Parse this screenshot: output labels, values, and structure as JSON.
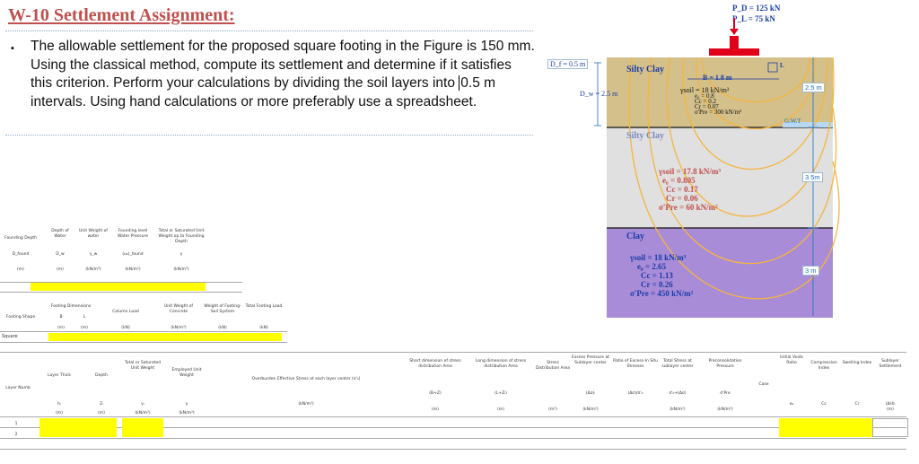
{
  "title": "W-10 Settlement Assignment:",
  "paragraph": {
    "bullet": "▪",
    "before": "The allowable settlement for the proposed square footing in the Figure is 150 mm. Using the classical method, compute its settlement and determine if it satisfies this criterion. Perform your calculations by dividing the soil layers into ",
    "highlight": "0.5 m",
    "after": " intervals. Using hand calculations or more preferably use a spreadsheet."
  },
  "figure": {
    "pd": "P_D = 125 kN",
    "pl": "P_L = 75 kN",
    "df": "D_f = 0.5 m",
    "dw": "D_w = 2.5 m",
    "b": "B = 1.8 m",
    "l_mark": "L",
    "gwt": "G.W.T",
    "dims": [
      "2.5 m",
      "3.5m",
      "3 m"
    ],
    "layer1": {
      "name": "Silty Clay",
      "gamma": "γsoil = 18 kN/m³",
      "e": "e₀ = 0.8",
      "cc": "Cc = 0.2",
      "cr": "Cr = 0.07",
      "pc": "σ'Pre = 300 kN/m²"
    },
    "layer2": {
      "name": "Silty Clay",
      "gamma": "γsoil = 17.8 kN/m³",
      "e": "e₀ = 0.805",
      "cc": "Cc = 0.17",
      "cr": "Cr = 0.06",
      "pc": "σ'Pre = 60 kN/m²"
    },
    "layer3": {
      "name": "Clay",
      "gamma": "γsoil = 18 kN/m³",
      "e": "e₀ = 2.65",
      "cc": "Cc = 1.13",
      "cr": "Cr = 0.26",
      "pc": "σ'Pre = 450 kN/m²"
    },
    "colors": {
      "layer1": "#d4c08a",
      "layer2": "#e0e0e0",
      "layer3": "#a98cd8",
      "footing": "#e0001a",
      "accent": "#c0504d"
    }
  },
  "sheet_top": {
    "headers": [
      "Founding Depth",
      "Depth of Water",
      "Unit Weight of water",
      "Founding level Water Pressure",
      "Total or Saturated Unit Weight up to Founding Depth"
    ],
    "symbols": [
      "D_found",
      "D_w",
      "γ_w",
      "(u₀)_found",
      "γ"
    ],
    "units": [
      "(m)",
      "(m)",
      "(kN/m³)",
      "(kN/m²)",
      "(kN/m³)"
    ]
  },
  "sheet_mid": {
    "headers": [
      "Footing Shape",
      "Footing Dimensions",
      "Column Load",
      "Unit Weight of Concrete",
      "Weight of Footing-Soil System",
      "Total Footing Load"
    ],
    "dims": [
      "B",
      "L"
    ],
    "units": [
      "(m)",
      "(m)",
      "(kN)",
      "(kN/m³)",
      "(kN)",
      "(kN)"
    ],
    "shape_value": "Square"
  },
  "sheet_bottom": {
    "headers": [
      "Layer Numb",
      "Layer Thick",
      "Depth",
      "Total or Saturated Unit Weight",
      "Employed Unit Weight",
      "Overburden Effective Stress at each layer center (σ'₀)",
      "Short dimension of stress distribution Area",
      "Long dimension of stress distribution Area",
      "Stress Distribution Area",
      "Excess Pressure at Sublayer center",
      "Ratio of Excess-In Situ Stresses",
      "Total Stress at sublayer center",
      "Preconsolidation Pressure",
      "Case",
      "Initial Voids Ratio",
      "Compression Index",
      "Swelling Index",
      "Sublayer Settlement"
    ],
    "symbols": [
      "",
      "hᵢ",
      "Zᵢ",
      "γᵢ",
      "γ",
      "(kN/m²)",
      "(B+Z)",
      "(L+Zᵢ)",
      "",
      "(Δσ)ᵢ",
      "(Δσ)/σ'₀",
      "σ'₀+(Δσ)",
      "σ'Pre",
      "",
      "e₀",
      "Cc",
      "Cr",
      "(ΔH)ᵢ"
    ],
    "units": [
      "",
      "(m)",
      "(m)",
      "(kN/m³)",
      "(kN/m³)",
      "",
      "(m)",
      "(m)",
      "(m²)",
      "(kN/m²)",
      "",
      "(kN/m²)",
      "(kN/m²)",
      "",
      "",
      "",
      "",
      "(m)"
    ],
    "rows": [
      "1",
      "2"
    ]
  }
}
